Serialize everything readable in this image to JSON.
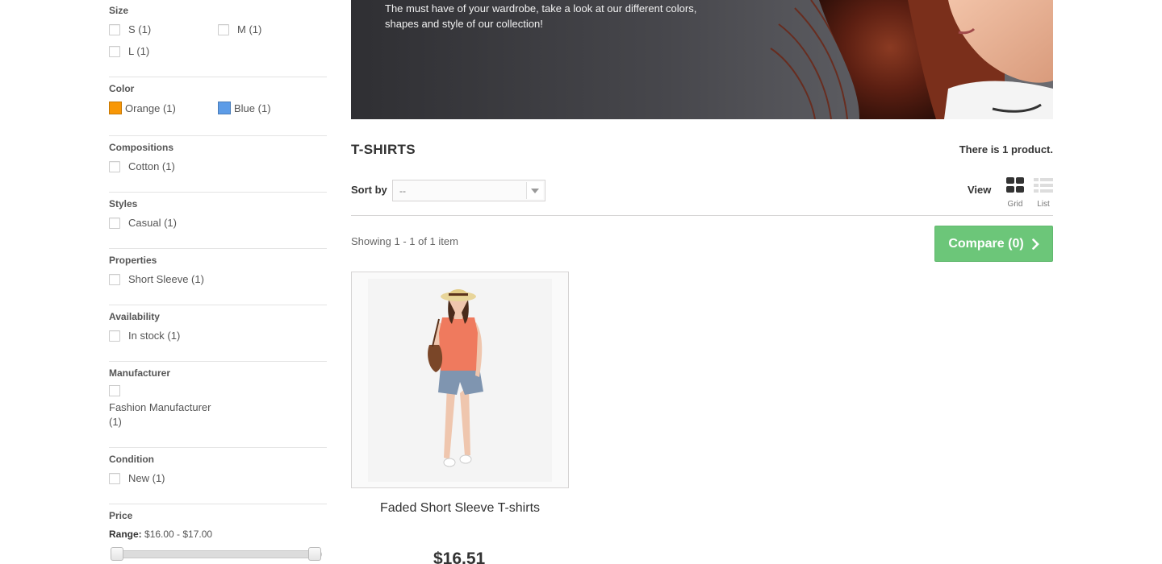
{
  "filters": {
    "size": {
      "title": "Size",
      "options": [
        "S (1)",
        "M (1)",
        "L (1)"
      ]
    },
    "color": {
      "title": "Color",
      "options": [
        {
          "label": "Orange (1)",
          "color": "#f89706"
        },
        {
          "label": "Blue (1)",
          "color": "#5d9ce7"
        }
      ]
    },
    "compositions": {
      "title": "Compositions",
      "options": [
        "Cotton (1)"
      ]
    },
    "styles": {
      "title": "Styles",
      "options": [
        "Casual (1)"
      ]
    },
    "properties": {
      "title": "Properties",
      "options": [
        "Short Sleeve (1)"
      ]
    },
    "availability": {
      "title": "Availability",
      "options": [
        "In stock (1)"
      ]
    },
    "manufacturer": {
      "title": "Manufacturer",
      "options": [
        "Fashion Manufacturer (1)"
      ]
    },
    "condition": {
      "title": "Condition",
      "options": [
        "New (1)"
      ]
    },
    "price": {
      "title": "Price",
      "range_label": "Range:",
      "range_value": "$16.00 - $17.00"
    }
  },
  "banner": {
    "text": "The must have of your wardrobe, take a look at our different colors, shapes and style of our collection!"
  },
  "category": {
    "title": "T-SHIRTS",
    "product_count": "There is 1 product."
  },
  "sort": {
    "label": "Sort by",
    "value": "--"
  },
  "view": {
    "label": "View",
    "grid": "Grid",
    "list": "List",
    "active": "grid"
  },
  "listing": {
    "showing": "Showing 1 - 1 of 1 item"
  },
  "compare": {
    "label": "Compare (0)"
  },
  "products": [
    {
      "name": "Faded Short Sleeve T-shirts",
      "price": "$16.51"
    }
  ],
  "colors": {
    "accent_green": "#43b754",
    "banner_dark": "#3a3a3e"
  }
}
